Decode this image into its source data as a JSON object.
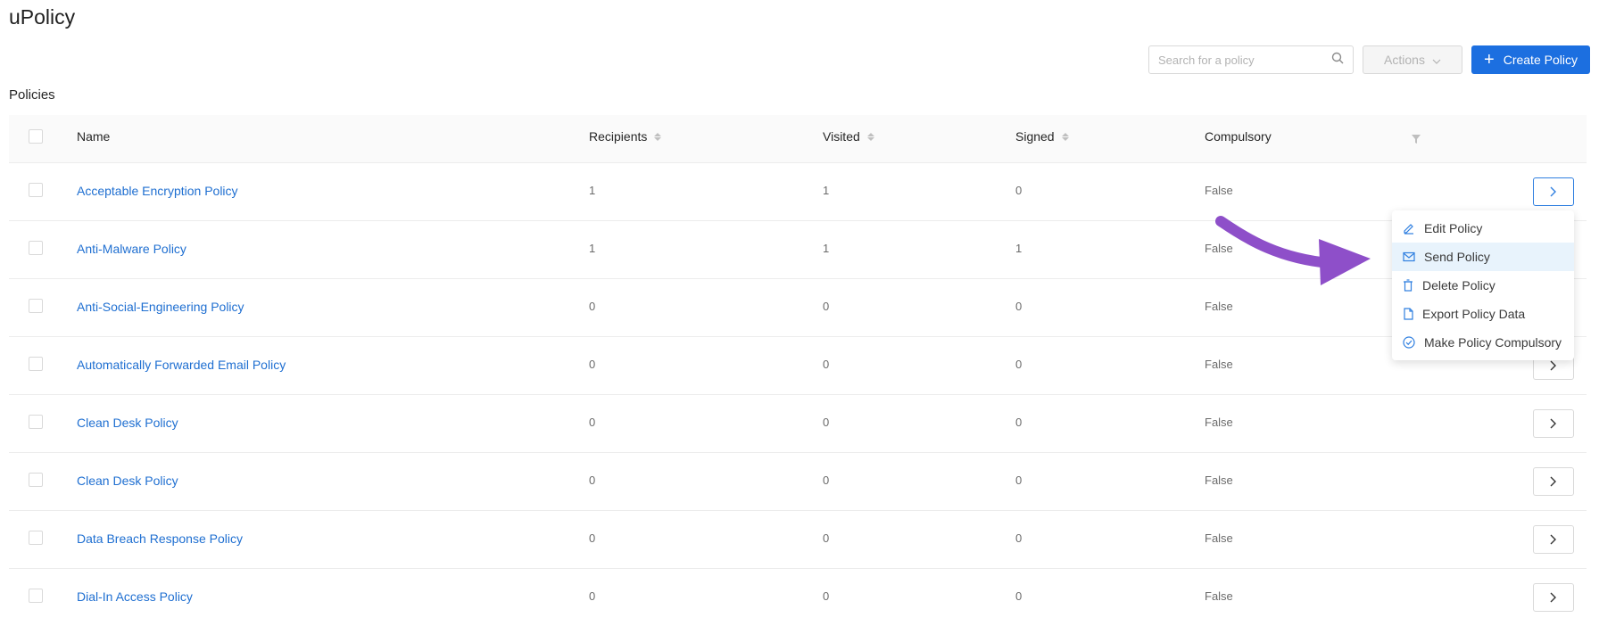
{
  "app": {
    "title": "uPolicy"
  },
  "toolbar": {
    "search_placeholder": "Search for a policy",
    "actions_label": "Actions",
    "create_label": "Create Policy",
    "accent_color": "#1c6fe0"
  },
  "section": {
    "title": "Policies"
  },
  "table": {
    "headers": {
      "name": "Name",
      "recipients": "Recipients",
      "visited": "Visited",
      "signed": "Signed",
      "compulsory": "Compulsory"
    },
    "rows": [
      {
        "name": "Acceptable Encryption Policy",
        "recipients": "1",
        "visited": "1",
        "signed": "0",
        "compulsory": "False"
      },
      {
        "name": "Anti-Malware Policy",
        "recipients": "1",
        "visited": "1",
        "signed": "1",
        "compulsory": "False"
      },
      {
        "name": "Anti-Social-Engineering Policy",
        "recipients": "0",
        "visited": "0",
        "signed": "0",
        "compulsory": "False"
      },
      {
        "name": "Automatically Forwarded Email Policy",
        "recipients": "0",
        "visited": "0",
        "signed": "0",
        "compulsory": "False"
      },
      {
        "name": "Clean Desk Policy",
        "recipients": "0",
        "visited": "0",
        "signed": "0",
        "compulsory": "False"
      },
      {
        "name": "Clean Desk Policy",
        "recipients": "0",
        "visited": "0",
        "signed": "0",
        "compulsory": "False"
      },
      {
        "name": "Data Breach Response Policy",
        "recipients": "0",
        "visited": "0",
        "signed": "0",
        "compulsory": "False"
      },
      {
        "name": "Dial-In Access Policy",
        "recipients": "0",
        "visited": "0",
        "signed": "0",
        "compulsory": "False"
      }
    ]
  },
  "context_menu": {
    "items": [
      {
        "label": "Edit Policy",
        "icon": "edit-icon"
      },
      {
        "label": "Send Policy",
        "icon": "mail-icon"
      },
      {
        "label": "Delete Policy",
        "icon": "trash-icon"
      },
      {
        "label": "Export Policy Data",
        "icon": "file-icon"
      },
      {
        "label": "Make Policy Compulsory",
        "icon": "check-circle-icon"
      }
    ],
    "highlighted": "Send Policy"
  },
  "annotation": {
    "arrow_color": "#8e4fc9"
  }
}
